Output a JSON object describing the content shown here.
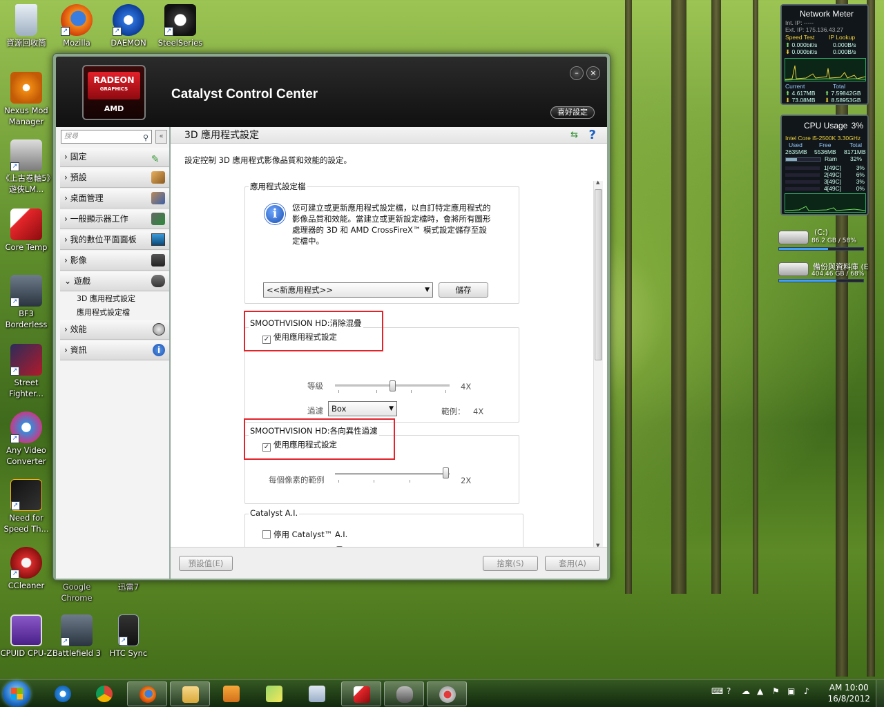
{
  "desktop": {
    "icons": [
      {
        "label": "資源回收筒"
      },
      {
        "label": "Mozilla"
      },
      {
        "label": "DAEMON"
      },
      {
        "label": "SteelSeries"
      },
      {
        "label": "Nexus Mod Manager"
      },
      {
        "label": "《上古卷軸5》遊俠LM..."
      },
      {
        "label": "Core Temp"
      },
      {
        "label": "BF3 Borderless"
      },
      {
        "label": "Street Fighter..."
      },
      {
        "label": "Any Video Converter"
      },
      {
        "label": "Need for Speed Th..."
      },
      {
        "label": "CCleaner"
      },
      {
        "label": "Google Chrome"
      },
      {
        "label": "迅雷7"
      },
      {
        "label": "CPUID CPU-Z"
      },
      {
        "label": "Battlefield 3"
      },
      {
        "label": "HTC Sync"
      }
    ]
  },
  "network_meter": {
    "title": "Network Meter",
    "int_ip": "Int. IP: -----",
    "ext_ip": "Ext. IP: 175.136.43.27",
    "speed_test": "Speed Test",
    "ip_lookup": "IP Lookup",
    "up_rate_1": "0.000bit/s",
    "up_rate_2": "0.000B/s",
    "down_rate_1": "0.000bit/s",
    "down_rate_2": "0.000B/s",
    "current_label": "Current",
    "total_label": "Total",
    "current_up": "4.617MB",
    "current_down": "73.08MB",
    "total_up": "7.59842GB",
    "total_down": "8.58953GB"
  },
  "cpu_usage": {
    "title": "CPU Usage",
    "percent": "3%",
    "cpu_name": "Intel Core i5-2500K 3.30GHz",
    "used_label": "Used",
    "free_label": "Free",
    "total_label": "Total",
    "used": "2635MB",
    "free": "5536MB",
    "total": "8171MB",
    "ram_label": "Ram",
    "ram_percent": "32%",
    "ram_fill": 0.32,
    "cores": [
      {
        "label": "1[49C]",
        "value": "3%"
      },
      {
        "label": "2[49C]",
        "value": "6%"
      },
      {
        "label": "3[49C]",
        "value": "3%"
      },
      {
        "label": "4[49C]",
        "value": "0%"
      }
    ]
  },
  "drives": [
    {
      "name": "(C:)",
      "info": "86.2 GB / 58%",
      "fill": 0.58
    },
    {
      "name": "備份與資料庫 (E",
      "info": "404.46 GB / 68%",
      "fill": 0.68
    }
  ],
  "ccc": {
    "logo_brand": "RADEON",
    "logo_sub": "GRAPHICS",
    "logo_amd": "AMD",
    "title": "Catalyst Control Center",
    "preferences": "喜好設定",
    "minimize": "–",
    "close": "×",
    "search_placeholder": "搜尋",
    "nav": [
      {
        "label": "固定"
      },
      {
        "label": "預設"
      },
      {
        "label": "桌面管理"
      },
      {
        "label": "一般顯示器工作"
      },
      {
        "label": "我的數位平面面板"
      },
      {
        "label": "影像"
      },
      {
        "label": "遊戲"
      },
      {
        "label": "效能"
      },
      {
        "label": "資訊"
      }
    ],
    "nav_sub": [
      {
        "label": "3D 應用程式設定"
      },
      {
        "label": "應用程式設定檔"
      }
    ],
    "page_title": "3D 應用程式設定",
    "description": "設定控制 3D 應用程式影像品質和效能的設定。",
    "profile_group": {
      "label": "應用程式設定檔",
      "info": "您可建立或更新應用程式設定檔，以自訂特定應用程式的影像品質和效能。當建立或更新設定檔時，會將所有圖形處理器的 3D 和 AMD CrossFireX™ 模式設定儲存至設定檔中。",
      "select_value": "<<新應用程式>>",
      "save": "儲存"
    },
    "aa_group": {
      "label": "SMOOTHVISION HD:消除混疊",
      "checkbox": "使用應用程式設定",
      "level_label": "等級",
      "level_value": "4X",
      "filter_label": "過濾",
      "filter_value": "Box",
      "samples_label": "範例：",
      "samples_value": "4X"
    },
    "af_group": {
      "label": "SMOOTHVISION HD:各向異性過濾",
      "checkbox": "使用應用程式設定",
      "ppx_label": "每個像素的範例",
      "ppx_value": "2X"
    },
    "ai_group": {
      "label": "Catalyst A.I.",
      "checkbox": "停用 Catalyst™ A.I."
    },
    "buttons": {
      "defaults": "預設值(E)",
      "discard": "捨棄(S)",
      "apply": "套用(A)"
    }
  },
  "taskbar": {
    "clock_time": "AM 10:00",
    "clock_date": "16/8/2012"
  },
  "colors": {
    "accent_red": "#e2232a",
    "radeon_red": "#d01a22",
    "header_dark": "#1a1a1a"
  }
}
